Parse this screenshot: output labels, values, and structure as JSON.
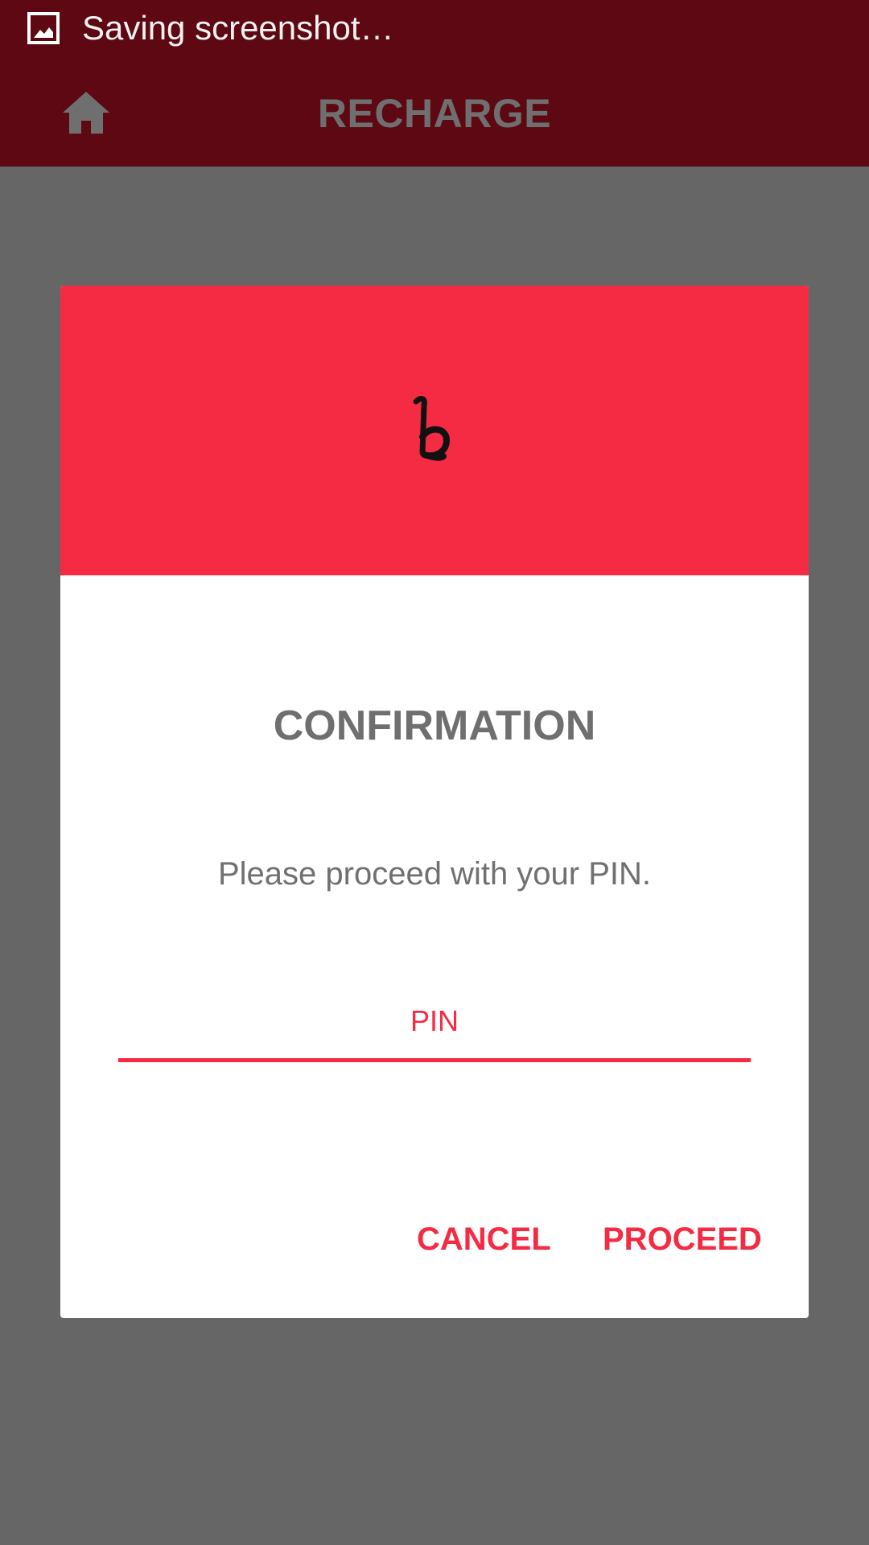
{
  "status_bar": {
    "icon": "screenshot-image-icon",
    "text": "Saving screenshot…"
  },
  "app_bar": {
    "home_icon": "home-icon",
    "title": "RECHARGE"
  },
  "dialog": {
    "header_icon": "bkash-logo-icon",
    "title": "CONFIRMATION",
    "message": "Please proceed with your PIN.",
    "pin_placeholder": "PIN",
    "pin_value": "",
    "cancel_label": "CANCEL",
    "proceed_label": "PROCEED"
  },
  "colors": {
    "status_bar": "#5e0813",
    "app_bar": "#5e0813",
    "scrim": "#666666",
    "accent": "#f52b44",
    "title_text": "#6f6f6f",
    "body_text": "#707070",
    "dialog_bg": "#ffffff"
  }
}
